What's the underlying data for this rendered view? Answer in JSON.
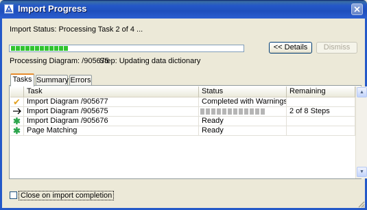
{
  "window": {
    "title": "Import Progress"
  },
  "status_text": "Import Status: Processing Task 2 of 4 ...",
  "progress": {
    "fraction": 0.27,
    "segments_done": 12
  },
  "processing": {
    "diagram": "Processing Diagram: /905675",
    "step": "Step: Updating data dictionary"
  },
  "buttons": {
    "details": "<< Details",
    "dismiss": "Dismiss"
  },
  "tabs": [
    {
      "label": "Tasks",
      "active": true
    },
    {
      "label": "Summary",
      "active": false
    },
    {
      "label": "Errors",
      "active": false
    }
  ],
  "columns": {
    "task": "Task",
    "status": "Status",
    "remaining": "Remaining"
  },
  "rows": [
    {
      "icon": "check-icon",
      "task": "Import Diagram /905677",
      "status": "Completed with Warnings",
      "remaining": ""
    },
    {
      "icon": "arrow-right-icon",
      "task": "Import Diagram /905675",
      "status": "",
      "status_progress": 0.25,
      "remaining": "2 of 8 Steps"
    },
    {
      "icon": "pending-star-icon",
      "task": "Import Diagram /905676",
      "status": "Ready",
      "remaining": ""
    },
    {
      "icon": "pending-star-icon",
      "task": "Page Matching",
      "status": "Ready",
      "remaining": ""
    }
  ],
  "close_on_completion": {
    "label": "Close on import completion",
    "checked": false
  },
  "colors": {
    "titlebar": "#2458c8",
    "progress": "#31c430",
    "active_tab": "#e68b2c",
    "check": "#e2a120",
    "star": "#2aa44a"
  }
}
